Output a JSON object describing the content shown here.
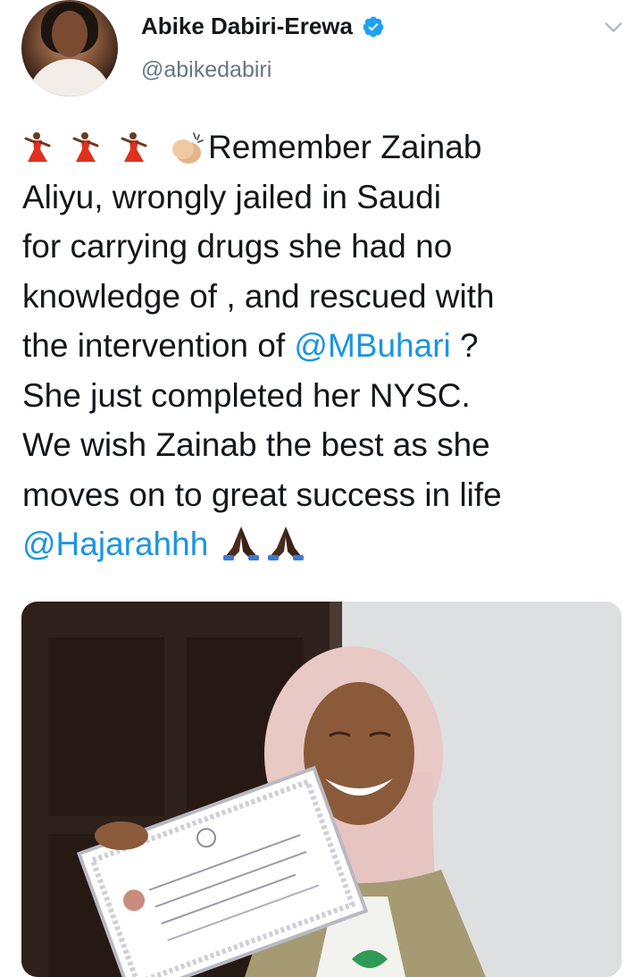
{
  "author": {
    "name": "Abike Dabiri-Erewa",
    "handle": "@abikedabiri",
    "verified": true
  },
  "tweet": {
    "line1": "Remember Zainab",
    "line2": "Aliyu, wrongly jailed in Saudi",
    "line3": "for carrying drugs she had no",
    "line4": "knowledge of , and rescued with",
    "line5_prefix": "the intervention of ",
    "mention1": "@MBuhari",
    "line5_suffix": " ?",
    "line6": "She just completed her NYSC.",
    "line7": "We wish Zainab the best as she",
    "line8": "moves on to great success in life",
    "mention2": "@Hajarahhh",
    "emojis_lead": [
      "woman-dancing-emoji",
      "woman-dancing-emoji",
      "woman-dancing-emoji",
      "clapping-hands-emoji"
    ],
    "emojis_trail": [
      "folded-hands-emoji",
      "folded-hands-emoji"
    ]
  },
  "colors": {
    "link": "#1b95e0",
    "secondary_text": "#657786",
    "verified_badge": "#1da1f2"
  },
  "media": {
    "type": "photo",
    "icon": "photo-of-woman-holding-certificate"
  }
}
